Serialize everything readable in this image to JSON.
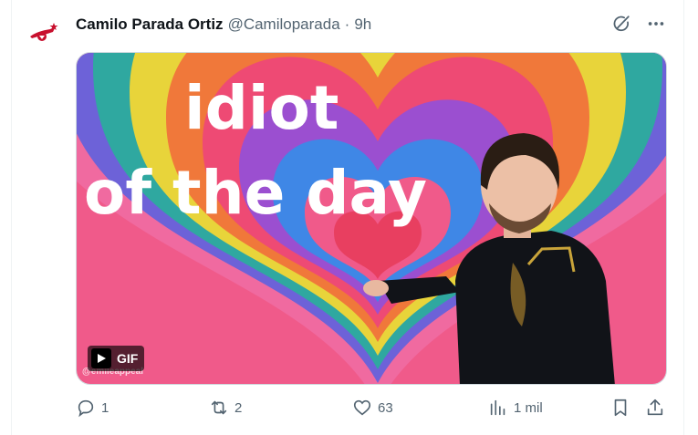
{
  "author": {
    "name": "Camilo Parada Ortiz",
    "handle": "@Camiloparada",
    "separator": "·",
    "time": "9h"
  },
  "media": {
    "caption_line1": "idiot",
    "caption_line2": "of the day",
    "badge_label": "GIF",
    "watermark": "@emileappeal"
  },
  "actions": {
    "replies": "1",
    "reposts": "2",
    "likes": "63",
    "views": "1 mil"
  },
  "icons": {
    "header": [
      "grok-icon",
      "more-icon"
    ],
    "actions": [
      "reply-icon",
      "repost-icon",
      "like-icon",
      "views-icon",
      "bookmark-icon",
      "share-icon"
    ]
  },
  "colors": {
    "text_primary": "#0f1419",
    "text_secondary": "#536471",
    "border": "#cfd9de"
  }
}
